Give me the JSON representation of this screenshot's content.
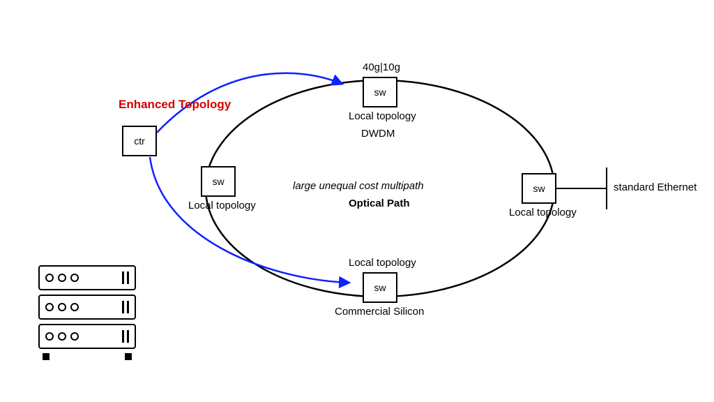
{
  "title": "Enhanced Topology",
  "controller": {
    "label": "ctr"
  },
  "switches": {
    "top": {
      "label": "sw",
      "caption_above": "40g|10g",
      "caption_below": "Local topology"
    },
    "left": {
      "label": "sw",
      "caption_below": "Local topology"
    },
    "right": {
      "label": "sw",
      "caption_below": "Local topology"
    },
    "bottom": {
      "label": "sw",
      "caption_above": "Local topology",
      "caption_below": "Commercial Silicon"
    }
  },
  "ring_labels": {
    "upper": "DWDM",
    "mid": "large unequal cost multipath",
    "lower": "Optical Path"
  },
  "external_link": "standard Ethernet",
  "server": {
    "name": "server-rack"
  }
}
